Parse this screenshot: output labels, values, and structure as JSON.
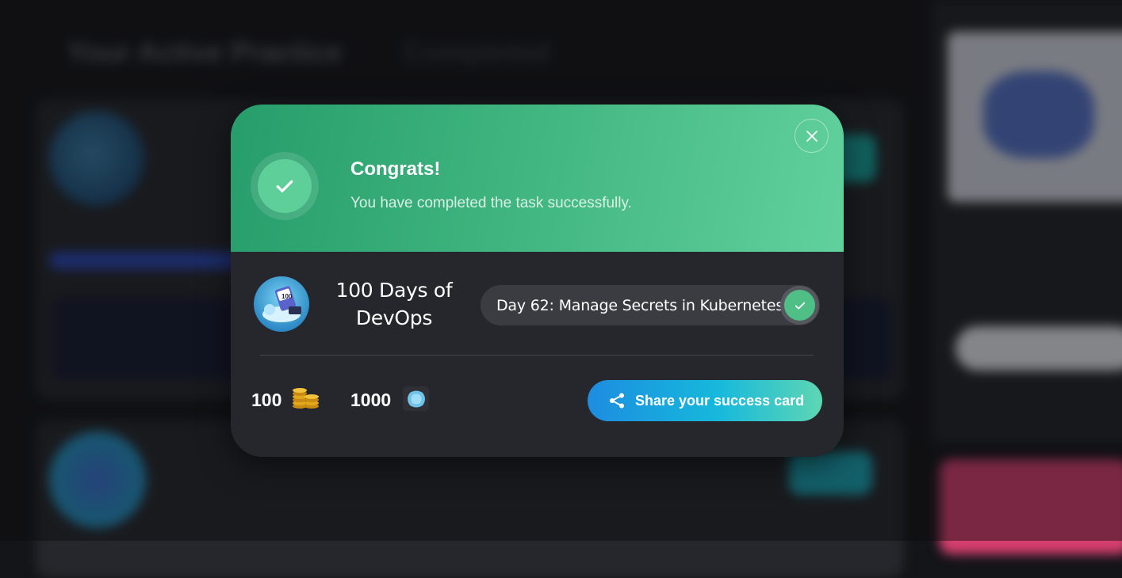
{
  "background": {
    "tab_active": "Your Active Practice",
    "tab_other": "Completed"
  },
  "modal": {
    "title": "Congrats!",
    "subtitle": "You have completed the task successfully.",
    "close_icon": "close-icon",
    "success_icon": "checkmark-icon",
    "course": {
      "name_line1": "100 Days of",
      "name_line2": "DevOps",
      "logo_text": "100"
    },
    "task": {
      "label": "Day 62: Manage Secrets in Kubernetes",
      "status_icon": "checkmark-icon"
    },
    "rewards": {
      "coins": "100",
      "coins_icon": "coins-icon",
      "gems": "1000",
      "gems_icon": "gem-icon"
    },
    "share_button": {
      "label": "Share your success card",
      "icon": "share-icon"
    },
    "colors": {
      "header_gradient_start": "#279d6b",
      "header_gradient_end": "#61d09d",
      "body": "#25272c",
      "share_gradient_start": "#1d8de0",
      "share_gradient_end": "#5ed6b4"
    }
  }
}
